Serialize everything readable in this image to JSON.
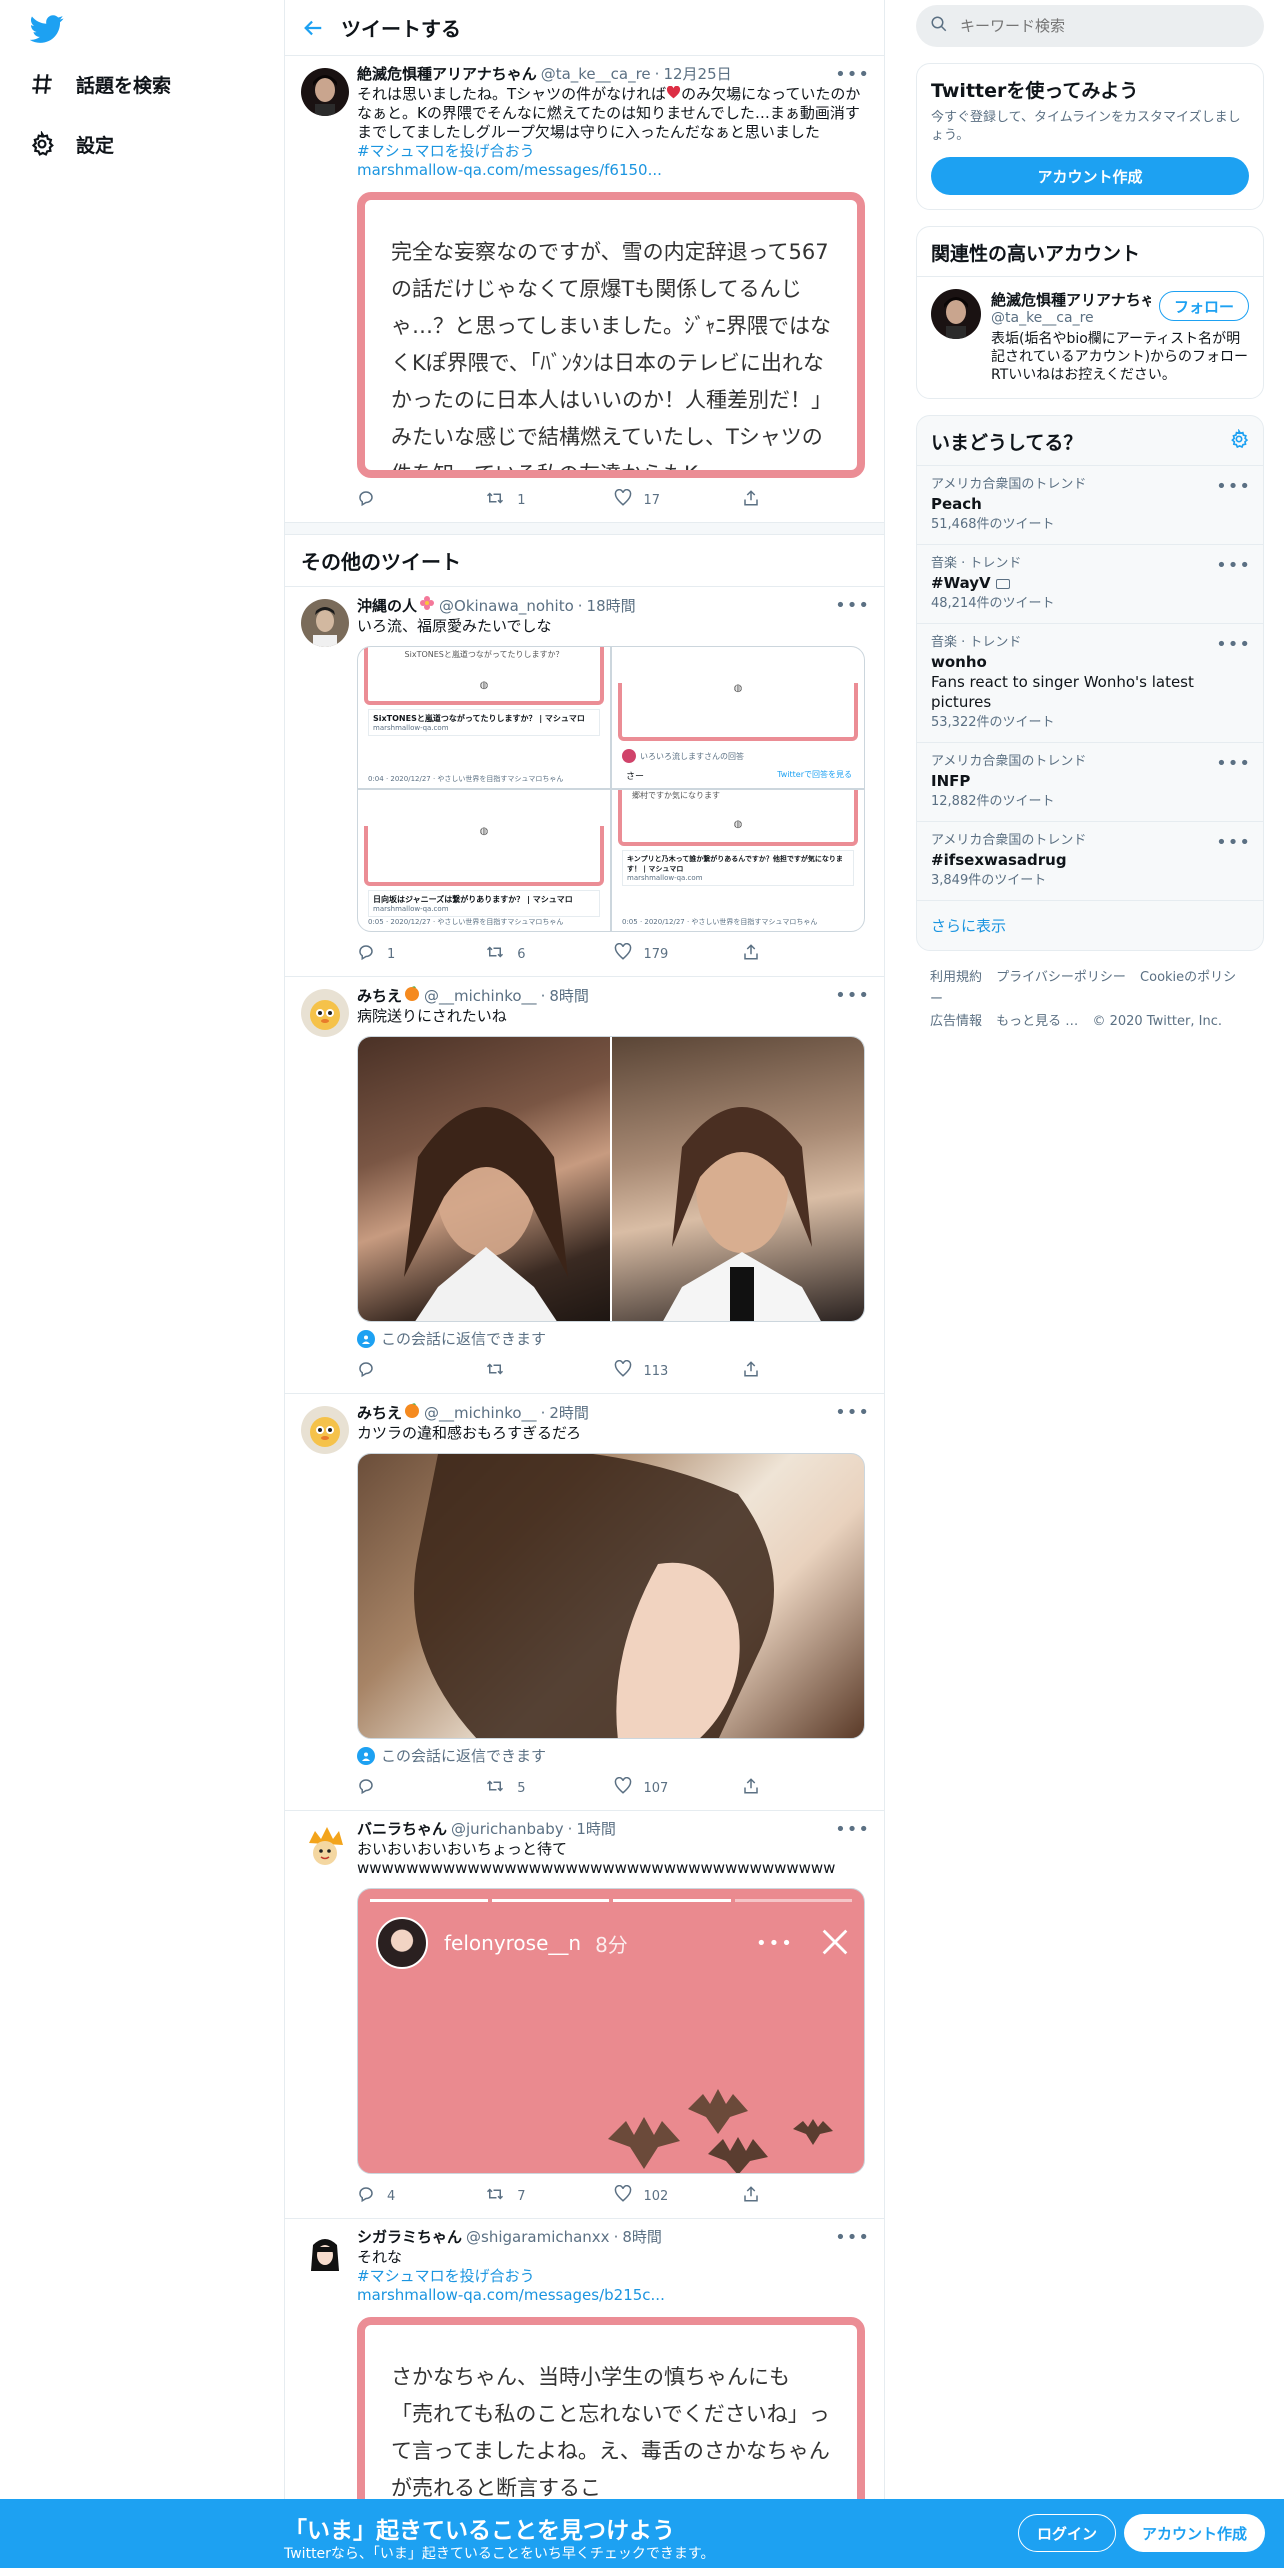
{
  "nav": {
    "items": [
      {
        "label": "話題を検索",
        "icon": "hashtag-icon"
      },
      {
        "label": "設定",
        "icon": "gear-icon"
      }
    ]
  },
  "header": {
    "title": "ツイートする"
  },
  "main_tweet": {
    "name": "絶滅危惧種アリアナちゃん",
    "handle": "@ta_ke__ca_re",
    "dot": "·",
    "time": "12月25日",
    "text_before_heart": "それは思いましたね。Tシャツの件がなければ",
    "text_after_heart": "のみ欠場になっていたのかなぁと。Kの界隈でそんなに燃えてたのは知りませんでした…まぁ動画消すまでしてましたしグループ欠場は守りに入ったんだなぁと思いました",
    "hashtag": "#マシュマロを投げ合おう",
    "link": "marshmallow-qa.com/messages/f6150...",
    "card_text": "完全な妄察なのですが、雪の内定辞退って567の話だけじゃなくて原爆Tも関係してるんじゃ…？と思ってしまいました。ｼﾞｬﾆ界隈ではなくKぽ界隈で、「ﾊﾞﾝﾀﾝは日本のテレビに出れなかったのに日本人はいいのか！人種差別だ！」みたいな感じで結構燃えていたし、Tシャツの件を知っている私の友達からもK",
    "reply_count": "",
    "retweet_count": "1",
    "like_count": "17"
  },
  "other_title": "その他のツイート",
  "tweets": [
    {
      "name": "沖縄の人",
      "handle": "@Okinawa_nohito",
      "dot": "·",
      "time": "18時間",
      "text": "いろ流、福原愛みたいでしな",
      "reply_count": "1",
      "retweet_count": "6",
      "like_count": "179",
      "grid": {
        "q1_title": "SixTONESと嵐道つながってたりしますか？",
        "q1_card": "SixTONESと嵐道つながってたりしますか？ | マシュマロ",
        "q1_domain": "marshmallow-qa.com",
        "q1_time": "0:04 · 2020/12/27 · やさしい世界を目指すマシュマロちゃん",
        "q2_head": "いろいろ流しますさんの回答",
        "q2_answer": "さー",
        "q2_link": "Twitterで回答を見る",
        "q3_card": "日向坂はジャニーズは繋がりありますか？ | マシュマロ",
        "q3_domain": "marshmallow-qa.com",
        "q3_time": "0:05 · 2020/12/27 · やさしい世界を目指すマシュマロちゃん",
        "q4_text": "郷村ですか気になります",
        "q4_card": "キンプリと乃木って誰か繋がりあるんですか？他担ですが気になります！ | マシュマロ",
        "q4_domain": "marshmallow-qa.com",
        "q4_time": "0:05 · 2020/12/27 · やさしい世界を目指すマシュマロちゃん"
      }
    },
    {
      "name": "みちえ",
      "handle": "@__michinko__",
      "dot": "·",
      "time": "8時間",
      "text": "病院送りにされたいね",
      "reply_note": "この会話に返信できます",
      "reply_count": "",
      "retweet_count": "",
      "like_count": "113"
    },
    {
      "name": "みちえ",
      "handle": "@__michinko__",
      "dot": "·",
      "time": "2時間",
      "text": "カツラの違和感おもろすぎるだろ",
      "reply_note": "この会話に返信できます",
      "reply_count": "",
      "retweet_count": "5",
      "like_count": "107"
    },
    {
      "name": "バニラちゃん",
      "handle": "@jurichanbaby",
      "dot": "·",
      "time": "1時間",
      "text": "おいおいおいおいちょっと待て\nwwwwwwwwwwwwwwwwwwwwwwwwwwwwwwwwwwwwwww",
      "story_user": "felonyrose__n",
      "story_time": "8分",
      "reply_count": "4",
      "retweet_count": "7",
      "like_count": "102"
    },
    {
      "name": "シガラミちゃん",
      "handle": "@shigaramichanxx",
      "dot": "·",
      "time": "8時間",
      "text": "それな",
      "hashtag": "#マシュマロを投げ合おう",
      "link": "marshmallow-qa.com/messages/b215c...",
      "card_text": "さかなちゃん、当時小学生の慎ちゃんにも「売れても私のこと忘れないでくださいね」って言ってましたよね。え、毒舌のさかなちゃんが売れると断言するこ"
    }
  ],
  "right": {
    "search_placeholder": "キーワード検索",
    "signup": {
      "title": "Twitterを使ってみよう",
      "sub": "今すぐ登録して、タイムラインをカスタマイズしましょう。",
      "button": "アカウント作成"
    },
    "related": {
      "title": "関連性の高いアカウント",
      "name": "絶滅危惧種アリアナちゃん",
      "handle": "@ta_ke__ca_re",
      "follow": "フォロー",
      "bio": "表垢(垢名やbio欄にアーティスト名が明記されているアカウント)からのフォローRTいいねはお控えください。"
    },
    "trends": {
      "title": "いまどうしてる？",
      "items": [
        {
          "cat": "アメリカ合衆国のトレンド",
          "name": "Peach",
          "desc": "",
          "count": "51,468件のツイート"
        },
        {
          "cat": "音楽 · トレンド",
          "name": "#WayV",
          "desc": "",
          "count": "48,214件のツイート"
        },
        {
          "cat": "音楽 · トレンド",
          "name": "wonho",
          "desc": "Fans react to singer Wonho's latest pictures",
          "count": "53,322件のツイート"
        },
        {
          "cat": "アメリカ合衆国のトレンド",
          "name": "INFP",
          "desc": "",
          "count": "12,882件のツイート"
        },
        {
          "cat": "アメリカ合衆国のトレンド",
          "name": "#ifsexwasadrug",
          "desc": "",
          "count": "3,849件のツイート"
        }
      ],
      "show_more": "さらに表示"
    },
    "footer": {
      "links": [
        "利用規約",
        "プライバシーポリシー",
        "Cookieのポリシー",
        "広告情報",
        "もっと見る …"
      ],
      "copyright": "© 2020 Twitter, Inc."
    }
  },
  "bottom": {
    "title": "「いま」起きていることを見つけよう",
    "sub": "Twitterなら、「いま」起きていることをいち早くチェックできます。",
    "login": "ログイン",
    "signup": "アカウント作成"
  },
  "colors": {
    "accent": "#1da1f2",
    "link": "#1b95e0",
    "card_border": "#eb8d95",
    "heart": "#e0245e"
  }
}
